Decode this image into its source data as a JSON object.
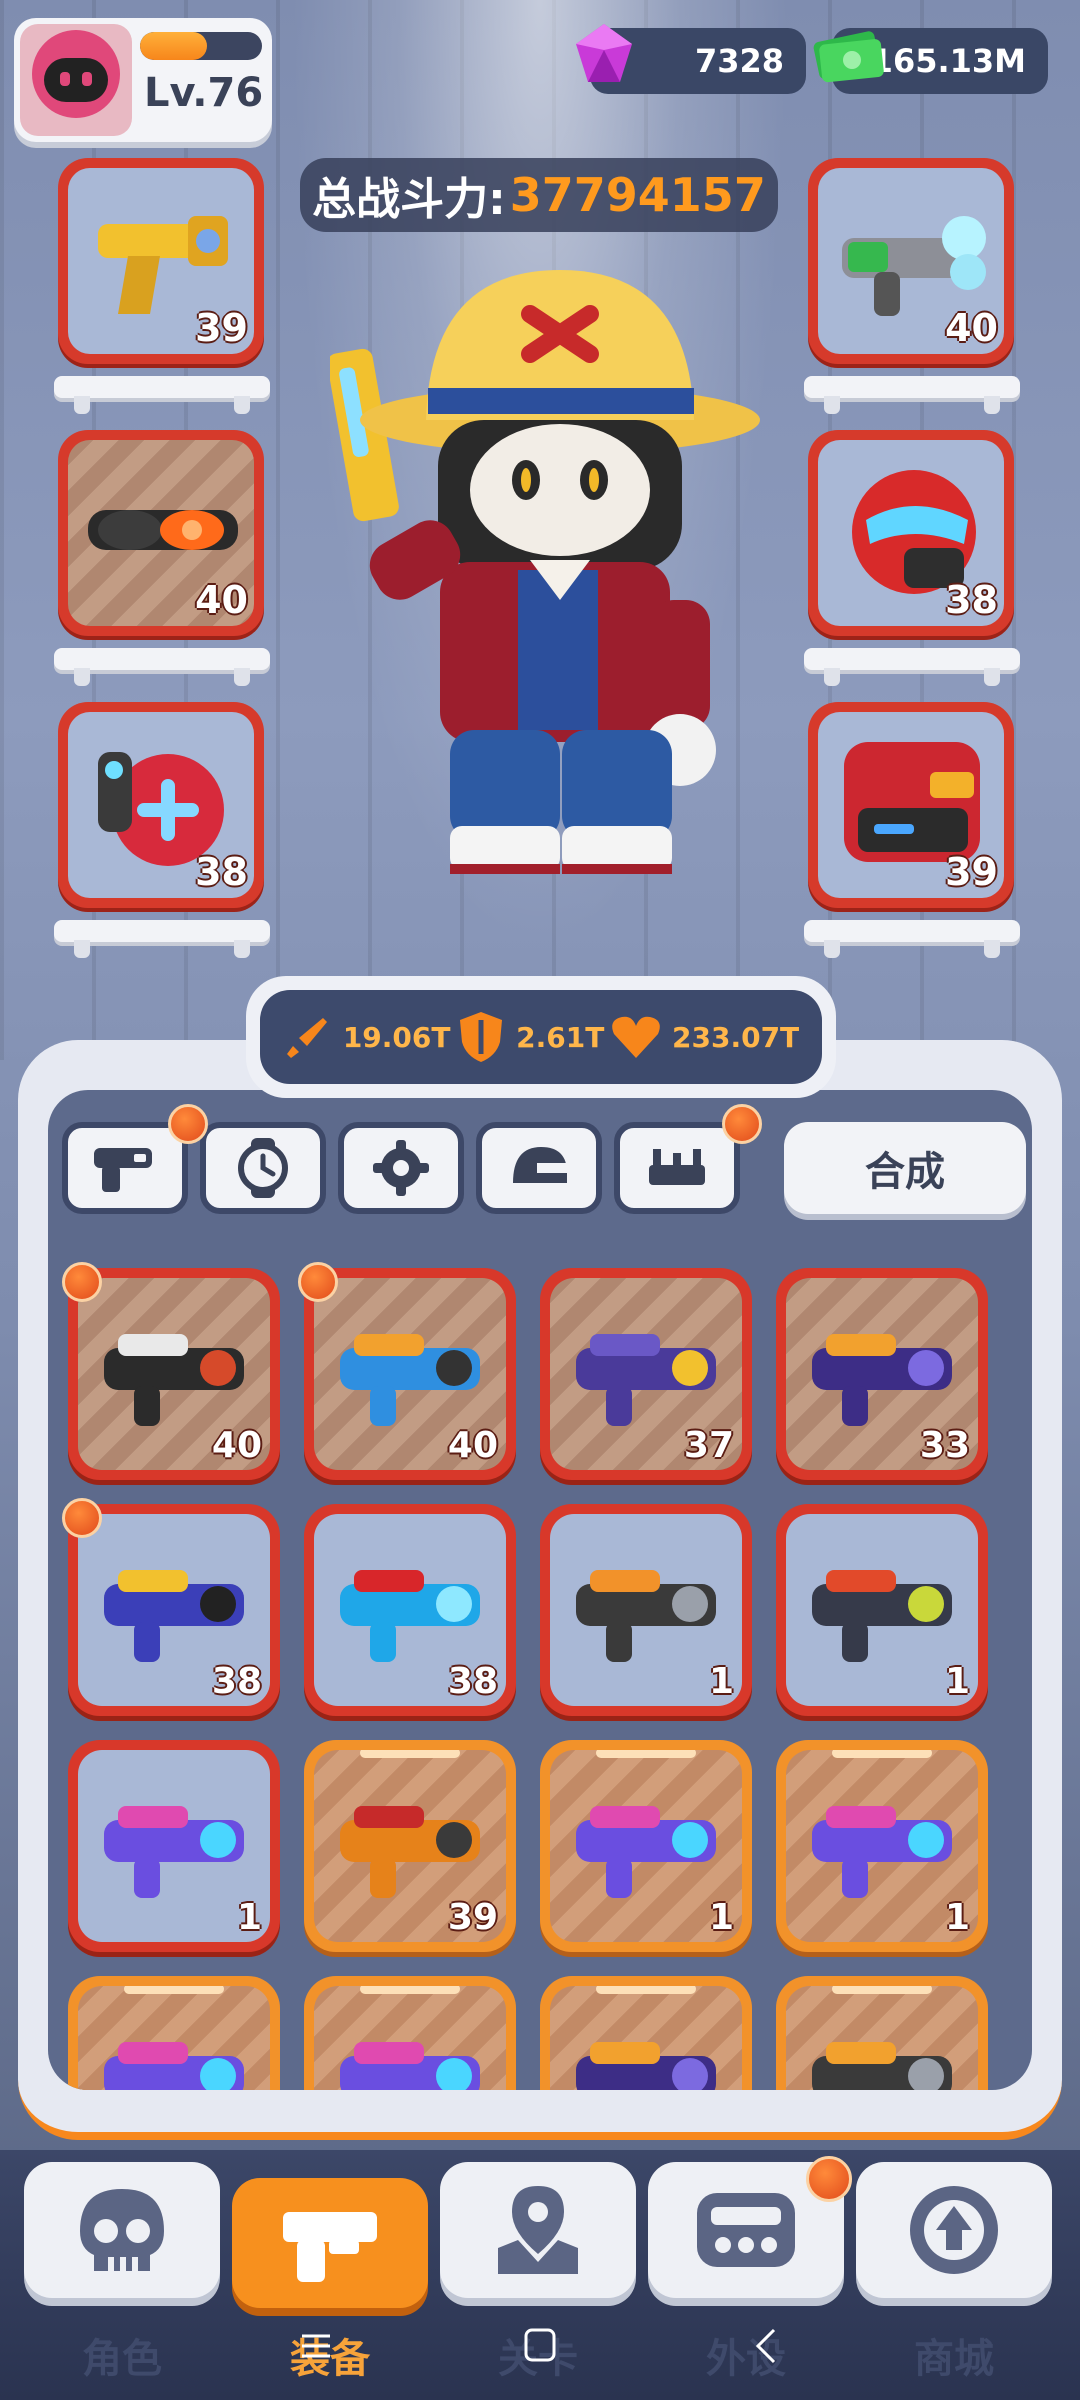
{
  "player": {
    "level": "Lv.76",
    "xp_fraction": 0.55
  },
  "currencies": {
    "gems": "7328",
    "cash": "165.13M"
  },
  "power": {
    "label": "总战斗力:",
    "value": "37794157"
  },
  "equipped": {
    "left": [
      {
        "name": "gold-revolver",
        "level": "39"
      },
      {
        "name": "tactical-goggles",
        "level": "40"
      },
      {
        "name": "red-backpack",
        "level": "38"
      }
    ],
    "right": [
      {
        "name": "plasma-blaster",
        "level": "40"
      },
      {
        "name": "red-helmet",
        "level": "38"
      },
      {
        "name": "red-armor",
        "level": "39"
      }
    ]
  },
  "stats": {
    "attack": "19.06T",
    "defense": "2.61T",
    "health": "233.07T"
  },
  "tabs": {
    "merge_label": "合成"
  },
  "inventory": [
    {
      "item": "jacket",
      "level": "40",
      "frame": "red",
      "dot": true
    },
    {
      "item": "blue-pistol",
      "level": "40",
      "frame": "red",
      "dot": true
    },
    {
      "item": "purple-jacket",
      "level": "37",
      "frame": "red",
      "dot": false
    },
    {
      "item": "purple-watch",
      "level": "33",
      "frame": "red",
      "dot": false
    },
    {
      "item": "purple-shotgun",
      "level": "38",
      "frame": "red",
      "dot": true
    },
    {
      "item": "blue-goggles",
      "level": "38",
      "frame": "red",
      "dot": false
    },
    {
      "item": "gas-mask",
      "level": "1",
      "frame": "red",
      "dot": false
    },
    {
      "item": "dark-armor",
      "level": "1",
      "frame": "red",
      "dot": false
    },
    {
      "item": "sniper-rifle",
      "level": "1",
      "frame": "red",
      "dot": false
    },
    {
      "item": "orange-rifle",
      "level": "39",
      "frame": "orange",
      "dot": false
    },
    {
      "item": "sniper-rifle",
      "level": "1",
      "frame": "orange",
      "dot": false
    },
    {
      "item": "sniper-rifle",
      "level": "1",
      "frame": "orange",
      "dot": false
    },
    {
      "item": "sniper-rifle",
      "level": "",
      "frame": "orange",
      "dot": false
    },
    {
      "item": "sniper-rifle",
      "level": "",
      "frame": "orange",
      "dot": false
    },
    {
      "item": "purple-watch",
      "level": "",
      "frame": "orange",
      "dot": false
    },
    {
      "item": "ammo-belt",
      "level": "",
      "frame": "orange",
      "dot": false
    }
  ],
  "nav": [
    {
      "label": "角色",
      "icon": "skull-icon"
    },
    {
      "label": "装备",
      "icon": "gun-icon",
      "active": true
    },
    {
      "label": "关卡",
      "icon": "map-pin-icon"
    },
    {
      "label": "外设",
      "icon": "gamepad-icon",
      "dot": true
    },
    {
      "label": "商城",
      "icon": "shop-icon"
    }
  ]
}
